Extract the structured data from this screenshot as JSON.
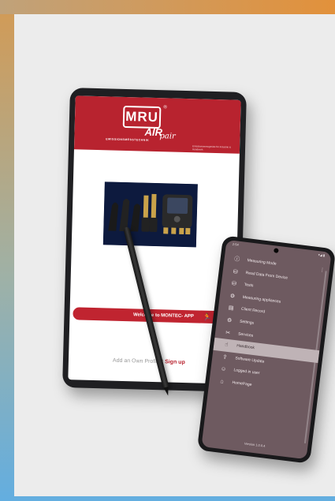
{
  "tablet": {
    "logo": {
      "brand": "MRU",
      "air": "AIR",
      "pair": "pair",
      "sub": "EMISSIONSMESSTECHNIK",
      "reg": "®"
    },
    "header_small": "Emissionsmessgeräte für Industrie & Handwerk",
    "welcome_text": "Welcome to MONTEC- APP",
    "welcome_icon": "runner-icon",
    "signup_prompt": "Add an Own Profile?",
    "signup_link": "Sign up"
  },
  "phone": {
    "status": {
      "time": "2:54",
      "icons": "▾◢ ▮"
    },
    "menu": [
      {
        "icon": "info-icon",
        "glyph": "ⓘ",
        "label": "Measuring Mode"
      },
      {
        "icon": "database-icon",
        "glyph": "⛁",
        "label": "Read Data From Device"
      },
      {
        "icon": "database-icon",
        "glyph": "⛁",
        "label": "Tests"
      },
      {
        "icon": "appliances-icon",
        "glyph": "⚙",
        "label": "Measuring appliances"
      },
      {
        "icon": "book-icon",
        "glyph": "▤",
        "label": "Client Record"
      },
      {
        "icon": "gear-icon",
        "glyph": "⚙",
        "label": "Settings"
      },
      {
        "icon": "services-icon",
        "glyph": "✂",
        "label": "Services"
      },
      {
        "icon": "handbook-icon",
        "glyph": "☝",
        "label": "Handbook",
        "active": true
      },
      {
        "icon": "update-icon",
        "glyph": "⇪",
        "label": "Software Update"
      },
      {
        "icon": "user-icon",
        "glyph": "☺",
        "label": "Logged in user"
      },
      {
        "icon": "home-icon",
        "glyph": "⌂",
        "label": "HomePage"
      }
    ],
    "version": "Version 1.0.0.4"
  }
}
